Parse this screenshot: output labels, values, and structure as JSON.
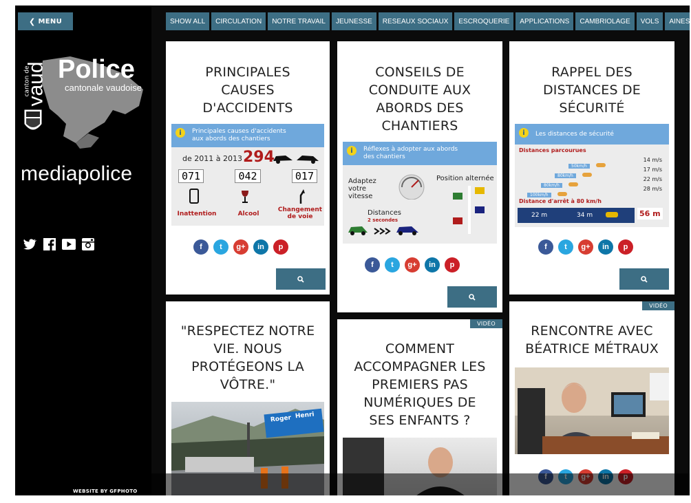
{
  "sidebar": {
    "menu_label": "MENU",
    "logo_small_top": "canton de",
    "logo_vaud": "vaud",
    "logo_police": "Police",
    "logo_cantonale": "cantonale vaudoise",
    "brand": "mediapolice",
    "social": [
      "twitter-icon",
      "facebook-icon",
      "youtube-icon",
      "instagram-icon"
    ],
    "credit": "WEBSITE BY GFPHOTO"
  },
  "nav": {
    "items": [
      "SHOW ALL",
      "CIRCULATION",
      "NOTRE TRAVAIL",
      "JEUNESSE",
      "RESEAUX SOCIAUX",
      "ESCROQUERIE",
      "APPLICATIONS",
      "CAMBRIOLAGE",
      "VOLS",
      "AINES"
    ]
  },
  "cards": [
    {
      "title": "PRINCIPALES\nCAUSES\nD'ACCIDENTS",
      "info_title": "Principales causes d'accidents aux abords des chantiers",
      "range": "de 2011 à 2013",
      "total": "294",
      "counts": [
        "071",
        "042",
        "017"
      ],
      "causes": [
        "Inattention",
        "Alcool",
        "Changement de voie"
      ]
    },
    {
      "title": "CONSEILS DE\nCONDUITE AUX\nABORDS DES\nCHANTIERS",
      "info_title": "Réflexes à adopter aux abords des chantiers",
      "adaptez": "Adaptez votre vitesse",
      "position": "Position alternée",
      "distances": "Distances",
      "secondes": "2 secondes"
    },
    {
      "title": "RAPPEL DES\nDISTANCES DE\nSÉCURITÉ",
      "info_title": "Les distances de sécurité",
      "parcourues": "Distances parcourues",
      "speeds": [
        "50km/h",
        "80km/h",
        "80km/h",
        "100km/h"
      ],
      "rates": [
        "14 m/s",
        "17 m/s",
        "22 m/s",
        "28 m/s"
      ],
      "arret": "Distance d'arrêt à 80 km/h",
      "reaction": "22 m",
      "freinage": "34 m",
      "total": "56 m"
    },
    {
      "title": "\"RESPECTEZ NOTRE\nVIE. NOUS\nPROTÉGEONS LA\nVÔTRE.\"",
      "sign_left": "Roger",
      "sign_right": "Henri"
    },
    {
      "badge": "VIDÉO",
      "title": "COMMENT\nACCOMPAGNER LES\nPREMIERS PAS\nNUMÉRIQUES DE\nSES ENFANTS ?"
    },
    {
      "badge": "VIDÉO",
      "title": "RENCONTRE AVEC\nBÉATRICE MÉTRAUX"
    }
  ],
  "share_labels": [
    "f",
    "t",
    "g+",
    "in",
    "p"
  ],
  "colors": {
    "accent": "#3d6e84",
    "background": "#0b0b0b",
    "card": "#ffffff"
  }
}
